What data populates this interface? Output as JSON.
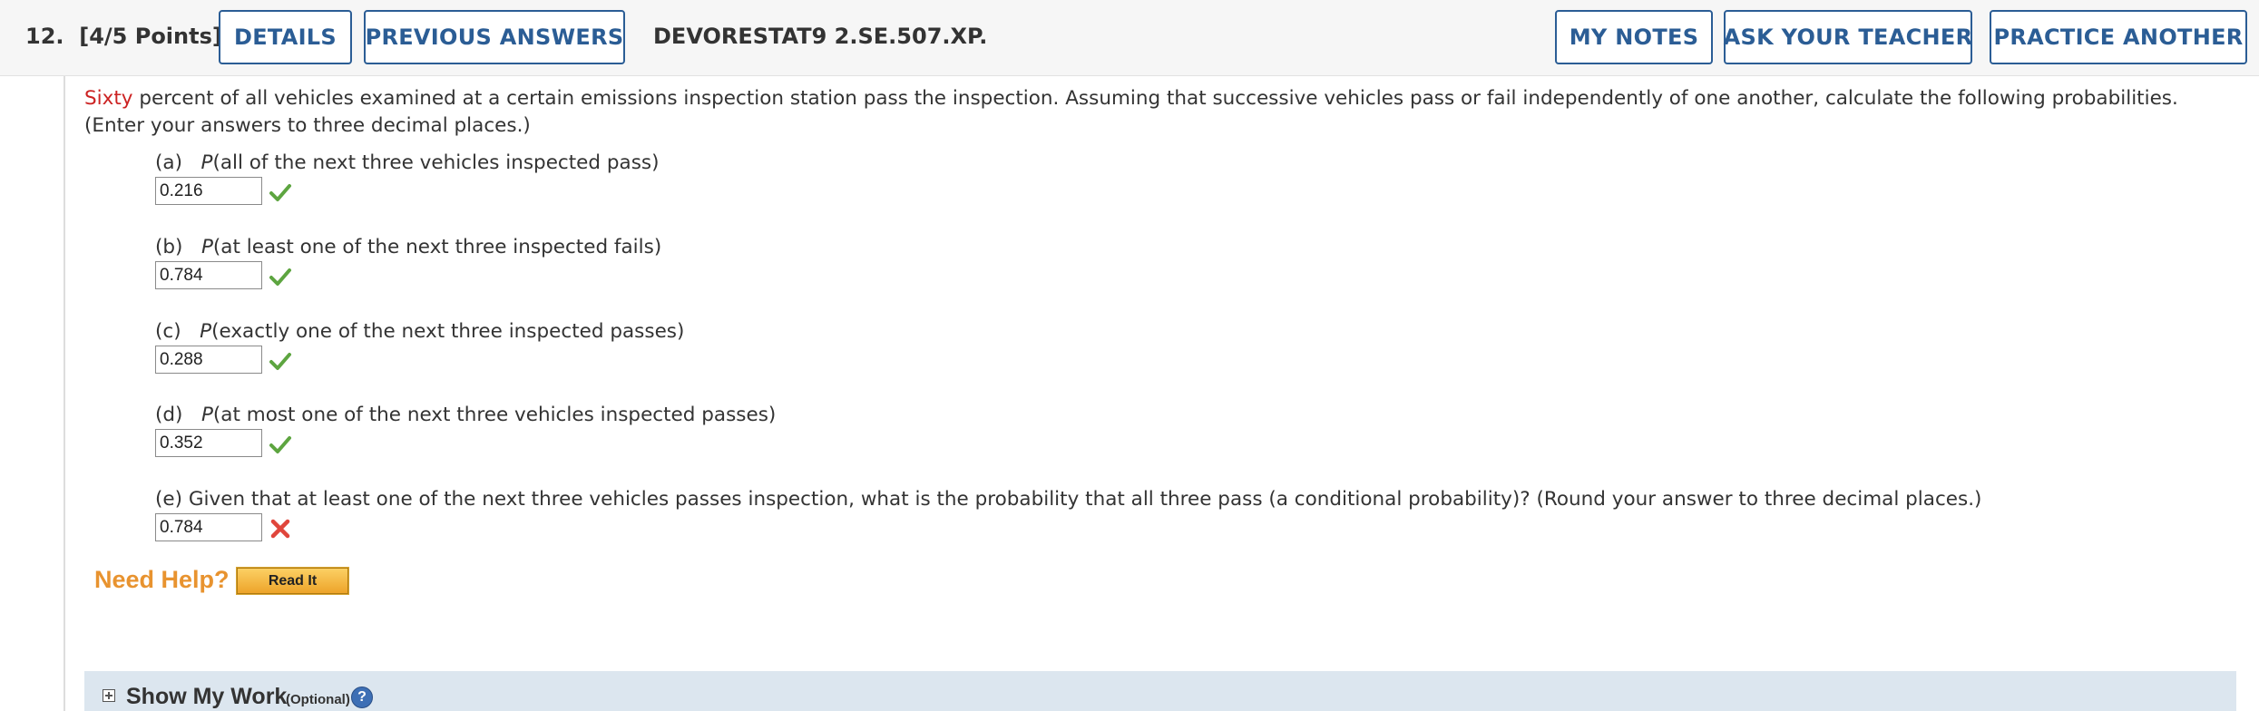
{
  "header": {
    "question_number": "12.",
    "points": "[4/5 Points]",
    "details_label": "DETAILS",
    "previous_answers_label": "PREVIOUS ANSWERS",
    "problem_code": "DEVORESTAT9 2.SE.507.XP.",
    "my_notes_label": "MY NOTES",
    "ask_teacher_label": "ASK YOUR TEACHER",
    "practice_another_label": "PRACTICE ANOTHER"
  },
  "prompt": {
    "highlight": "Sixty",
    "text": " percent of all vehicles examined at a certain emissions inspection station pass the inspection. Assuming that successive vehicles pass or fail independently of one another, calculate the following probabilities. (Enter your answers to three decimal places.)"
  },
  "parts": [
    {
      "letter": "(a)",
      "p": "P",
      "text": "(all of the next three vehicles inspected pass)",
      "answer": "0.216",
      "status": "correct"
    },
    {
      "letter": "(b)",
      "p": "P",
      "text": "(at least one of the next three inspected fails)",
      "answer": "0.784",
      "status": "correct"
    },
    {
      "letter": "(c)",
      "p": "P",
      "text": "(exactly one of the next three inspected passes)",
      "answer": "0.288",
      "status": "correct"
    },
    {
      "letter": "(d)",
      "p": "P",
      "text": "(at most one of the next three vehicles inspected passes)",
      "answer": "0.352",
      "status": "correct"
    },
    {
      "letter": "(e)",
      "text": "Given that at least one of the next three vehicles passes inspection, what is the probability that all three pass (a conditional probability)? (Round your answer to three decimal places.)",
      "answer": "0.784",
      "status": "incorrect"
    }
  ],
  "help": {
    "need_help_label": "Need Help?",
    "read_it_label": "Read It"
  },
  "show_my_work": {
    "title": "Show My Work",
    "optional": "(Optional)",
    "help_icon": "?"
  },
  "colors": {
    "button_blue": "#2b5d95",
    "highlight_red": "#cc2222",
    "correct_green": "#5da540",
    "incorrect_red": "#e0463c",
    "need_help_orange": "#e8932f",
    "show_work_bg": "#dce6ef"
  },
  "icons": {
    "correct": "check-icon",
    "incorrect": "x-icon",
    "expand": "plus-box-icon",
    "help": "question-circle-icon"
  }
}
